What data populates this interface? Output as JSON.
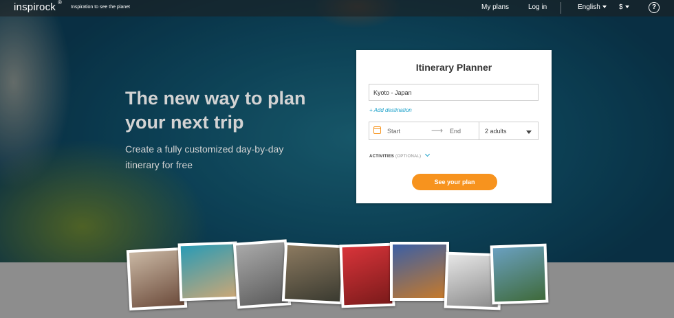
{
  "header": {
    "logo": "inspirock",
    "logo_mark": "®",
    "tagline": "Inspiration to see the planet",
    "nav": {
      "my_plans": "My plans",
      "log_in": "Log in",
      "language": "English",
      "currency": "$",
      "help": "?"
    }
  },
  "hero": {
    "headline": "The new way to plan your next trip",
    "subline": "Create a fully customized day-by-day itinerary for free"
  },
  "planner": {
    "title": "Itinerary Planner",
    "destination_value": "Kyoto - Japan",
    "add_destination": "+ Add destination",
    "start_label": "Start",
    "end_label": "End",
    "arrow": "⟶",
    "guests": "2 adults",
    "activities_label": "ACTIVITIES",
    "activities_optional": "(OPTIONAL)",
    "cta": "See your plan"
  },
  "photos": [
    {
      "name": "photo-friends",
      "colors": [
        "#c9b7a3",
        "#6b4a3a"
      ]
    },
    {
      "name": "photo-beach",
      "colors": [
        "#2a9bb5",
        "#c9a777"
      ]
    },
    {
      "name": "photo-statue",
      "colors": [
        "#a9a9a9",
        "#5b5b5b"
      ]
    },
    {
      "name": "photo-people",
      "colors": [
        "#8c7a60",
        "#3a3a30"
      ]
    },
    {
      "name": "photo-tulips",
      "colors": [
        "#d8343a",
        "#7a1a1a"
      ]
    },
    {
      "name": "photo-eiffel",
      "colors": [
        "#3b5fa5",
        "#c77a2a"
      ]
    },
    {
      "name": "photo-sculpture",
      "colors": [
        "#e6e6e6",
        "#8a8a8a"
      ]
    },
    {
      "name": "photo-mountains",
      "colors": [
        "#6aa0c0",
        "#3f6a3a"
      ]
    }
  ]
}
